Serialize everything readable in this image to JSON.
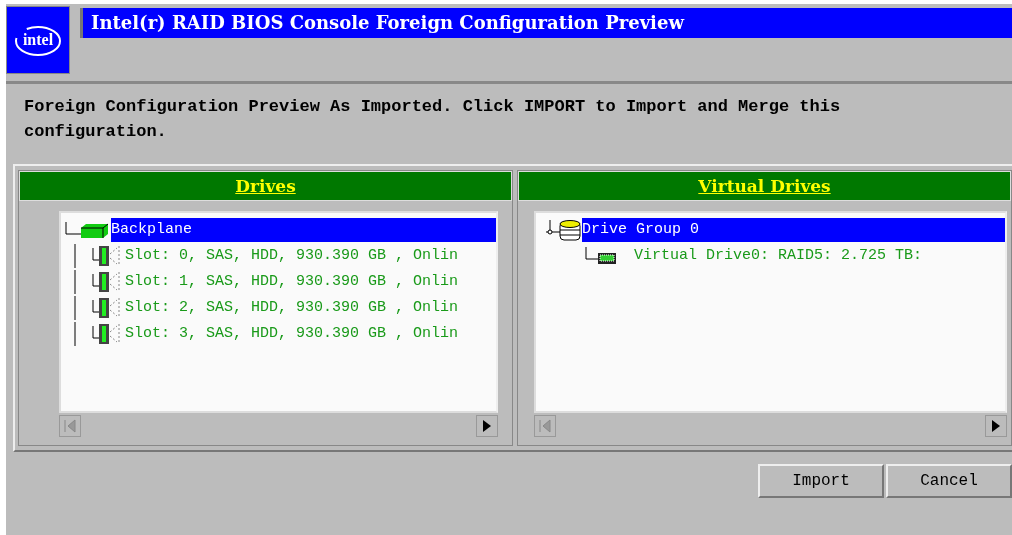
{
  "logo": {
    "text": "intel"
  },
  "window": {
    "title": "Intel(r) RAID BIOS Console  Foreign Configuration Preview"
  },
  "message": "Foreign Configuration Preview As Imported. Click IMPORT to Import and Merge this configuration.",
  "panels": [
    {
      "title": "Drives",
      "tree": [
        {
          "kind": "backplane",
          "label": "Backplane",
          "selected": true,
          "children": [
            {
              "kind": "disk",
              "label": "Slot: 0, SAS, HDD, 930.390 GB , Onlin",
              "selected": false
            },
            {
              "kind": "disk",
              "label": "Slot: 1, SAS, HDD, 930.390 GB , Onlin",
              "selected": false
            },
            {
              "kind": "disk",
              "label": "Slot: 2, SAS, HDD, 930.390 GB , Onlin",
              "selected": false
            },
            {
              "kind": "disk",
              "label": "Slot: 3, SAS, HDD, 930.390 GB , Onlin",
              "selected": false
            }
          ]
        }
      ]
    },
    {
      "title": "Virtual Drives",
      "tree": [
        {
          "kind": "group",
          "label": "Drive Group 0",
          "selected": true,
          "children": [
            {
              "kind": "virtual",
              "label": "Virtual Drive0: RAID5: 2.725 TB:",
              "selected": false
            }
          ]
        }
      ]
    }
  ],
  "buttons": [
    "Import",
    "Cancel"
  ]
}
